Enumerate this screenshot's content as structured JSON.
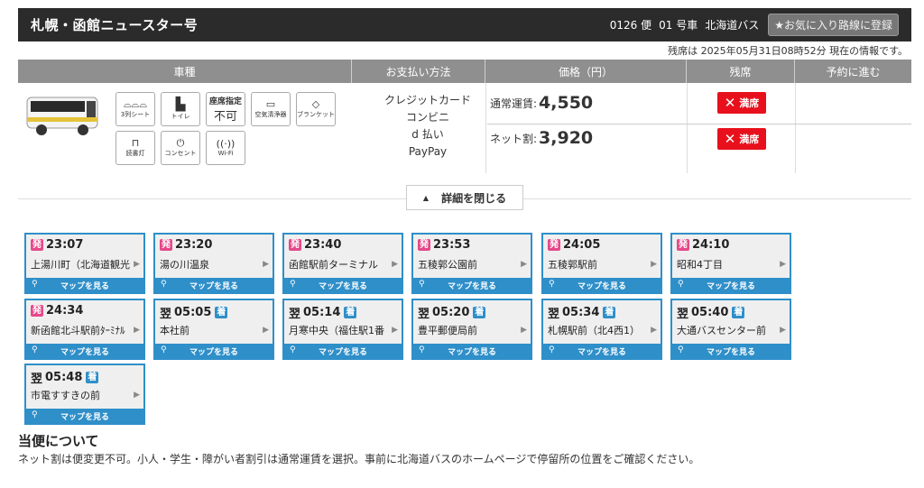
{
  "header": {
    "title": "札幌・函館ニュースター号",
    "flight": "0126 便",
    "car": "01 号車",
    "company": "北海道バス",
    "favorite_label": "★お気に入り路線に登録"
  },
  "status_text": "残席は 2025年05月31日08時52分 現在の情報です。",
  "columns": [
    "車種",
    "お支払い方法",
    "価格（円）",
    "残席",
    "予約に進む"
  ],
  "amenities": [
    {
      "label": "3列シート",
      "icon": "seat-icon",
      "glyph": "⌓⌓⌓"
    },
    {
      "label": "トイレ",
      "icon": "toilet-icon",
      "glyph": "🚽"
    },
    {
      "label": "不可",
      "icon": "seat-reserve-label",
      "glyph": "座席指定"
    },
    {
      "label": "空気清浄器",
      "icon": "air-purifier-icon",
      "glyph": "▭"
    },
    {
      "label": "ブランケット",
      "icon": "blanket-icon",
      "glyph": "◇"
    },
    {
      "label": "読書灯",
      "icon": "reading-light-icon",
      "glyph": "▯"
    },
    {
      "label": "コンセント",
      "icon": "outlet-icon",
      "glyph": "⏻"
    },
    {
      "label": "Wi-Fi",
      "icon": "wifi-icon",
      "glyph": "((·))"
    }
  ],
  "payment_methods": [
    "クレジットカード",
    "コンビニ",
    "d 払い",
    "PayPay"
  ],
  "prices": [
    {
      "label": "通常運賃:",
      "value": "4,550",
      "seat_status": "満席"
    },
    {
      "label": "ネット割:",
      "value": "3,920",
      "seat_status": "満席"
    }
  ],
  "detail_toggle_label": "詳細を閉じる",
  "map_label": "マップを見る",
  "dep_badge": "発",
  "arr_badge": "着",
  "next_day": "翌",
  "stops": [
    {
      "time": "23:07",
      "type": "dep",
      "next_day": false,
      "name": "上湯川町（北海道観光"
    },
    {
      "time": "23:20",
      "type": "dep",
      "next_day": false,
      "name": "湯の川温泉"
    },
    {
      "time": "23:40",
      "type": "dep",
      "next_day": false,
      "name": "函館駅前ターミナル"
    },
    {
      "time": "23:53",
      "type": "dep",
      "next_day": false,
      "name": "五稜郭公園前"
    },
    {
      "time": "24:05",
      "type": "dep",
      "next_day": false,
      "name": "五稜郭駅前"
    },
    {
      "time": "24:10",
      "type": "dep",
      "next_day": false,
      "name": "昭和4丁目"
    },
    {
      "time": "24:34",
      "type": "dep",
      "next_day": false,
      "name": "新函館北斗駅前ﾀｰﾐﾅﾙ"
    },
    {
      "time": "05:05",
      "type": "arr",
      "next_day": true,
      "name": "本社前"
    },
    {
      "time": "05:14",
      "type": "arr",
      "next_day": true,
      "name": "月寒中央（福住駅1番"
    },
    {
      "time": "05:20",
      "type": "arr",
      "next_day": true,
      "name": "豊平郵便局前"
    },
    {
      "time": "05:34",
      "type": "arr",
      "next_day": true,
      "name": "札幌駅前（北4西1）"
    },
    {
      "time": "05:40",
      "type": "arr",
      "next_day": true,
      "name": "大通バスセンター前"
    },
    {
      "time": "05:48",
      "type": "arr",
      "next_day": true,
      "name": "市電すすきの前"
    }
  ],
  "notes": {
    "title": "当便について",
    "body": "ネット割は便変更不可。小人・学生・障がい者割引は通常運賃を選択。事前に北海道バスのホームページで停留所の位置をご確認ください。"
  }
}
